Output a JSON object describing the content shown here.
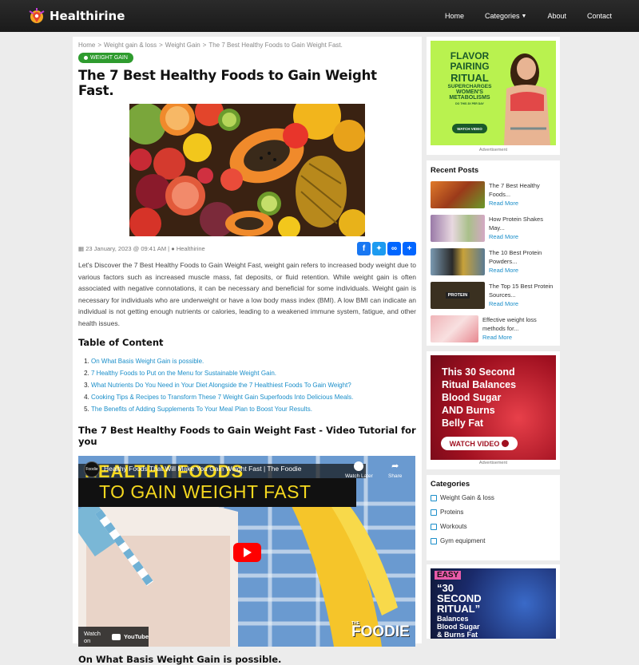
{
  "brand": {
    "name": "Healthirine"
  },
  "nav": {
    "items": [
      "Home",
      "Categories",
      "About",
      "Contact"
    ]
  },
  "breadcrumb": {
    "items": [
      "Home",
      "Weight gain & loss",
      "Weight Gain",
      "The 7 Best Healthy Foods to Gain Weight Fast."
    ],
    "separator": ">"
  },
  "article": {
    "tag": "WEIGHT GAIN",
    "title": "The 7 Best Healthy Foods to Gain Weight Fast.",
    "date": "23 January, 2023 @ 09:41 AM",
    "author": "Healthirine",
    "meta_separator": "|",
    "intro": "Let's Discover the 7 Best Healthy Foods to Gain Weight Fast, weight gain refers to increased body weight due to various factors such as increased muscle mass, fat deposits, or fluid retention. While weight gain is often associated with negative connotations, it can be necessary and beneficial for some individuals. Weight gain is necessary for individuals who are underweight or have a low body mass index (BMI). A low BMI can indicate an individual is not getting enough nutrients or calories, leading to a weakened immune system, fatigue, and other health issues.",
    "toc_heading": "Table of Content",
    "toc": [
      "On What Basis Weight Gain is possible.",
      "7 Healthy Foods to Put on the Menu for Sustainable Weight Gain.",
      "What Nutrients Do You Need in Your Diet Alongside the 7 Healthiest Foods To Gain Weight?",
      "Cooking Tips & Recipes to Transform These 7 Weight Gain Superfoods Into Delicious Meals.",
      "The Benefits of Adding Supplements To Your Meal Plan to Boost Your Results."
    ],
    "video_heading": "The 7 Best Healthy Foods to Gain Weight Fast - Video Tutorial for you",
    "section_heading": "On What Basis Weight Gain is possible."
  },
  "video": {
    "channel": "Foodie",
    "title": "Healthy Foods That Will Make You Gain Weight Fast | The Foodie",
    "watch_later": "Watch Later",
    "share": "Share",
    "overlay_line1": "HEALTHY FOODS",
    "overlay_line2": "TO GAIN WEIGHT FAST",
    "watch_on": "Watch on",
    "youtube": "YouTube",
    "watermark": "FOODIE",
    "watermark_small": "THE"
  },
  "share_icons": [
    "facebook-icon",
    "twitter-icon",
    "copy-link-icon",
    "share-plus-icon"
  ],
  "ad1": {
    "line1": "FLAVOR",
    "line2": "PAIRING",
    "line3": "RITUAL",
    "line4": "SUPERCHARGES",
    "line5": "WOMEN'S",
    "line6": "METABOLISMS",
    "line7": "DO THIS 3X PER DAY",
    "cta": "WATCH VIDEO",
    "label": "Advertisement"
  },
  "recent": {
    "title": "Recent Posts",
    "read_more": "Read More",
    "posts": [
      {
        "title": "The 7 Best Healthy Foods...",
        "thumb_color": "#c46a2a"
      },
      {
        "title": "How Protein Shakes May...",
        "thumb_color": "#8a6fa8"
      },
      {
        "title": "The 10 Best Protein Powders...",
        "thumb_color": "#4a6b82"
      },
      {
        "title": "The Top 15 Best Protein Sources...",
        "thumb_color": "#7a5a2e",
        "thumb_text": "PROTEIN"
      },
      {
        "title": "Effective weight loss methods for...",
        "thumb_color": "#e8a3a8"
      }
    ]
  },
  "ad2": {
    "line1": "This 30 Second",
    "line2": "Ritual Balances",
    "line3": "Blood Sugar",
    "line4": "AND Burns",
    "line5": "Belly Fat",
    "cta": "WATCH VIDEO",
    "label": "Advertisement"
  },
  "categories": {
    "title": "Categories",
    "items": [
      "Weight Gain & loss",
      "Proteins",
      "Workouts",
      "Gym equipment"
    ]
  },
  "ad3": {
    "badge": "EASY",
    "line1": "“30",
    "line2": "SECOND",
    "line3": "RITUAL”",
    "line4": "Balances",
    "line5": "Blood Sugar",
    "line6": "& Burns Fat"
  },
  "colors": {
    "accent": "#1a8ec9",
    "tag": "#2e9b2e",
    "topbar": "#1f1f1f",
    "ad_green": "#b5f04a",
    "ad_red": "#c0202a"
  }
}
